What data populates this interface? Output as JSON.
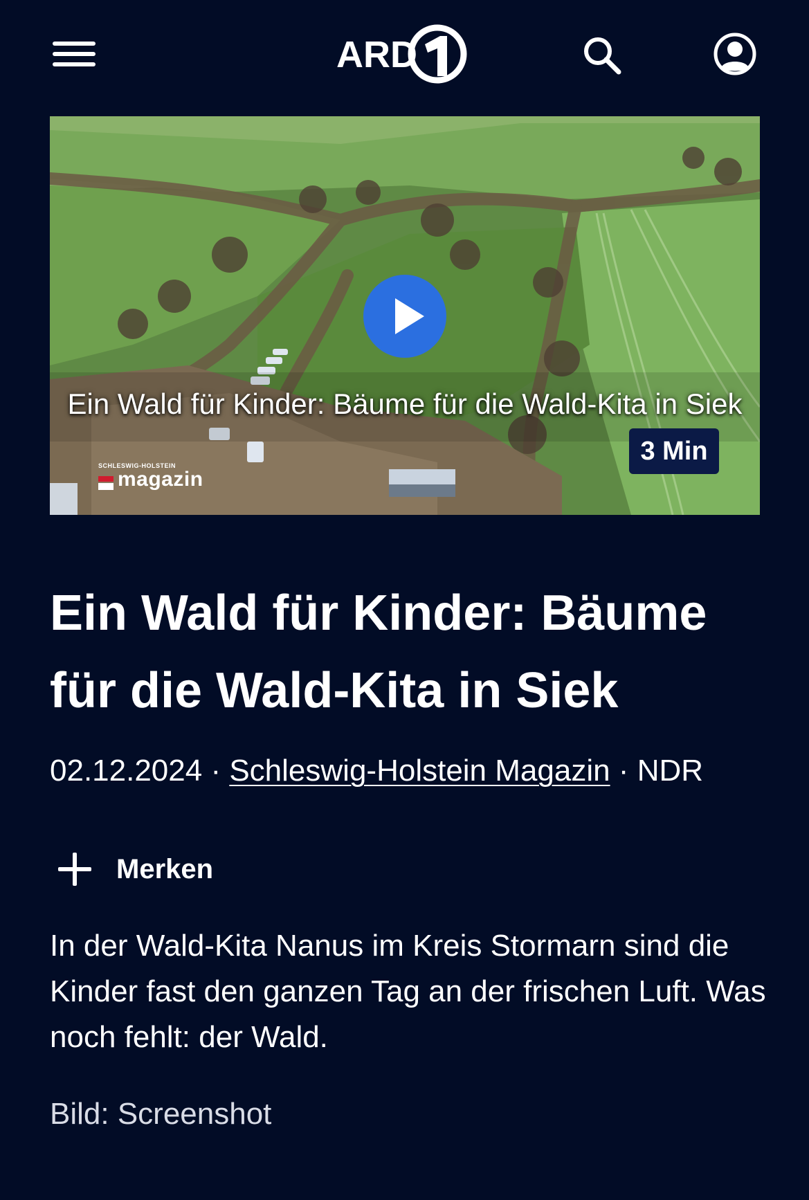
{
  "header": {
    "logo_text": "ARD",
    "icons": [
      "menu-icon",
      "search-icon",
      "account-icon"
    ]
  },
  "video": {
    "overlay_title": "Ein Wald für Kinder: Bäume für die Wald-Kita in Siek",
    "duration": "3 Min",
    "show_logo_top": "SCHLESWIG-HOLSTEIN",
    "show_logo_word": "magazin",
    "play_icon": "play-icon"
  },
  "article": {
    "title": "Ein Wald für Kinder: Bäume für die Wald-Kita in Siek",
    "date": "02.12.2024",
    "separator": " · ",
    "show": "Schleswig-Holstein Magazin",
    "broadcaster": "NDR",
    "bookmark_label": "Merken",
    "teaser": "In der Wald-Kita Nanus im Kreis Stormarn sind die Kinder fast den ganzen Tag an der frischen Luft. Was noch fehlt: der Wald.",
    "image_credit": "Bild: Screenshot"
  },
  "colors": {
    "background": "#020c26",
    "accent_blue": "#2b6fe0",
    "badge_bg": "#0b1a46"
  }
}
